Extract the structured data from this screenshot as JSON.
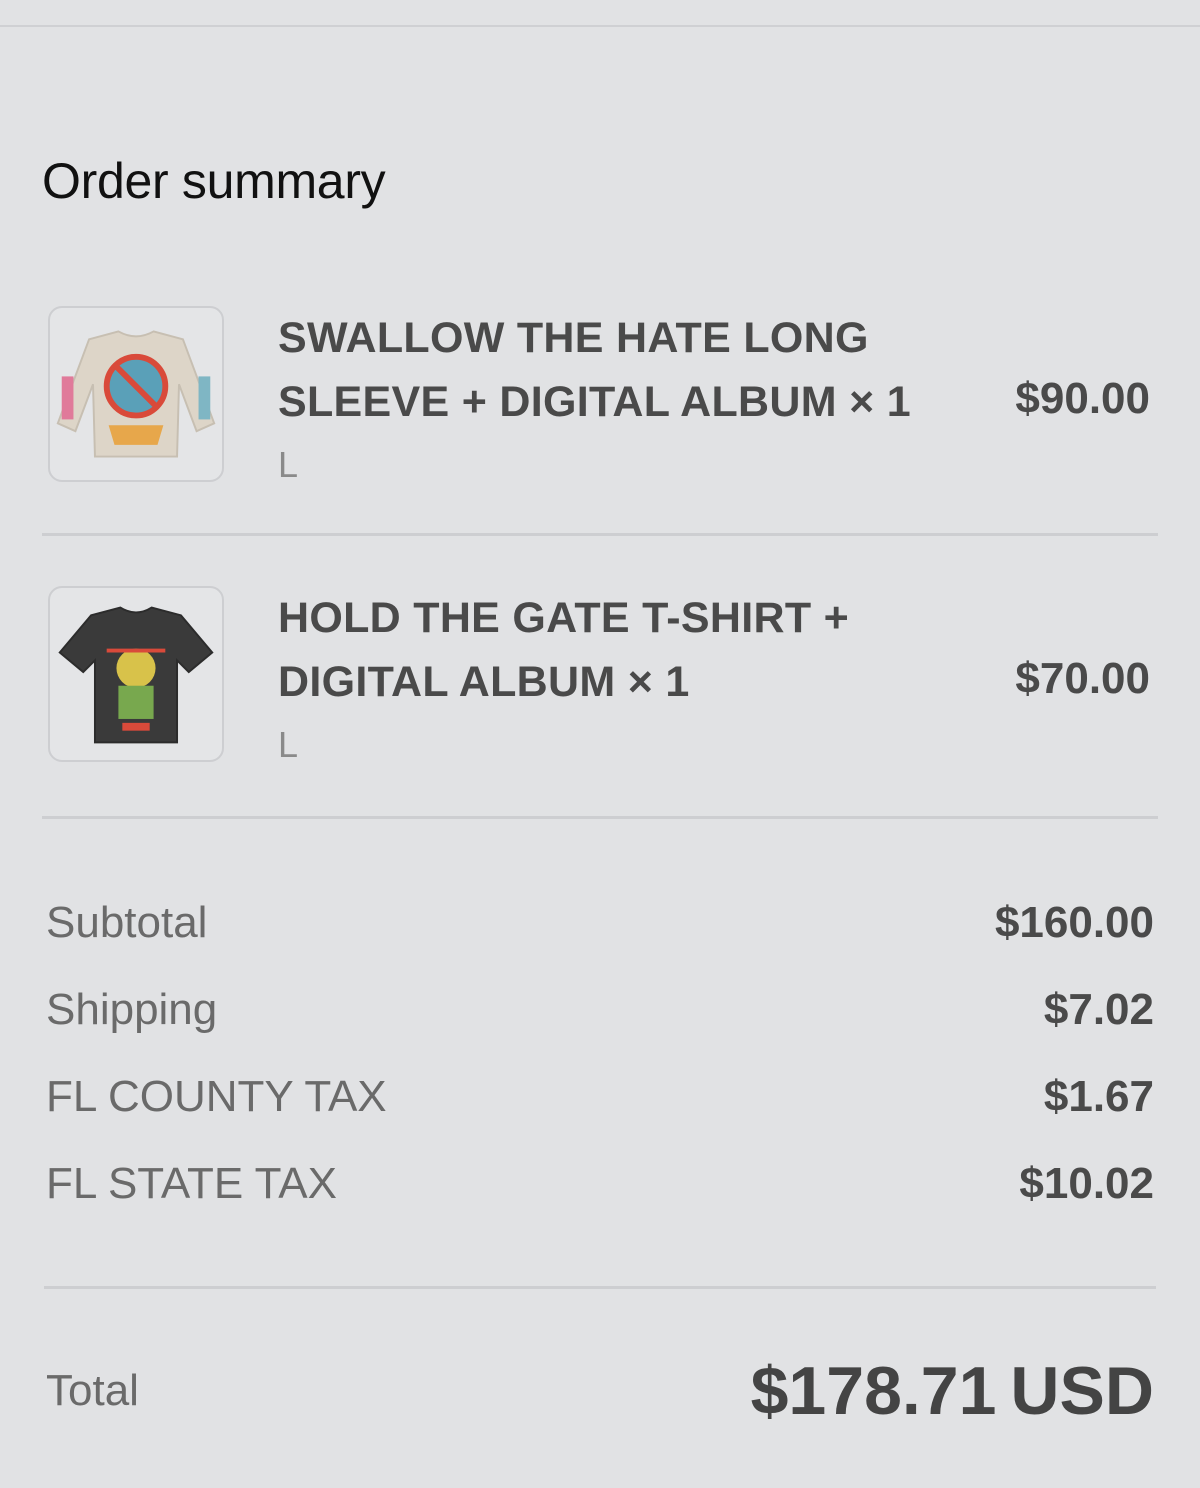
{
  "order_summary": {
    "title": "Order summary",
    "items": [
      {
        "name_line1": "SWALLOW THE HATE LONG",
        "name_line2": "SLEEVE + DIGITAL ALBUM × 1",
        "variant": "L",
        "price": "$90.00",
        "image_icon": "long-sleeve-shirt-icon"
      },
      {
        "name_line1": "HOLD THE GATE T-SHIRT +",
        "name_line2": "DIGITAL ALBUM × 1",
        "variant": "L",
        "price": "$70.00",
        "image_icon": "t-shirt-icon"
      }
    ],
    "lines": [
      {
        "label": "Subtotal",
        "value": "$160.00"
      },
      {
        "label": "Shipping",
        "value": "$7.02"
      },
      {
        "label": "FL COUNTY TAX",
        "value": "$1.67"
      },
      {
        "label": "FL STATE TAX",
        "value": "$10.02"
      }
    ],
    "total": {
      "label": "Total",
      "amount": "$178.71",
      "currency": "USD"
    }
  },
  "colors": {
    "background": "#e1e2e4",
    "divider": "#cdced1",
    "text_dark": "#4a4a4a",
    "text_muted": "#6a6a6a"
  }
}
